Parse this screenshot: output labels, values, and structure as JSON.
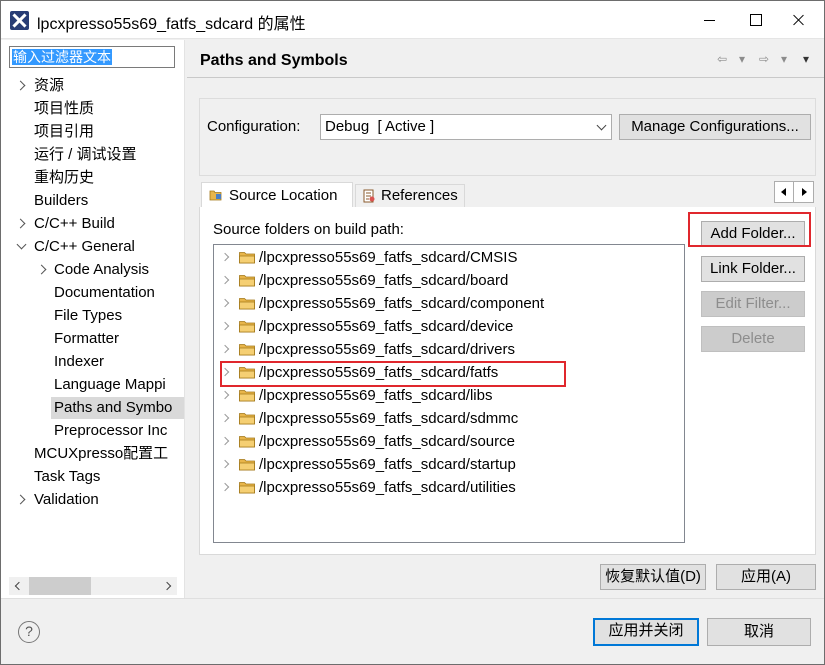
{
  "window": {
    "title": "lpcxpresso55s69_fatfs_sdcard 的属性",
    "icon": "app-x-icon"
  },
  "filter": {
    "value": "输入过滤器文本"
  },
  "nav": {
    "items": [
      {
        "label": "资源",
        "arrow": "right"
      },
      {
        "label": "项目性质",
        "arrow": ""
      },
      {
        "label": "项目引用",
        "arrow": ""
      },
      {
        "label": "运行 / 调试设置",
        "arrow": ""
      },
      {
        "label": "重构历史",
        "arrow": ""
      },
      {
        "label": "Builders",
        "arrow": ""
      },
      {
        "label": "C/C++ Build",
        "arrow": "right"
      },
      {
        "label": "C/C++ General",
        "arrow": "down"
      },
      {
        "label": "Code Analysis",
        "arrow": "right"
      },
      {
        "label": "Documentation",
        "arrow": ""
      },
      {
        "label": "File Types",
        "arrow": ""
      },
      {
        "label": "Formatter",
        "arrow": ""
      },
      {
        "label": "Indexer",
        "arrow": ""
      },
      {
        "label": "Language Mappi",
        "arrow": ""
      },
      {
        "label": "Paths and Symbo",
        "arrow": "",
        "selected": true
      },
      {
        "label": "Preprocessor Inc",
        "arrow": ""
      },
      {
        "label": "MCUXpresso配置工",
        "arrow": ""
      },
      {
        "label": "Task Tags",
        "arrow": ""
      },
      {
        "label": "Validation",
        "arrow": "right"
      }
    ]
  },
  "page": {
    "title": "Paths and Symbols"
  },
  "config": {
    "label": "Configuration:",
    "selected": "Debug  [ Active ]",
    "manage_label": "Manage Configurations..."
  },
  "tabs": {
    "source_location": "Source Location",
    "references": "References"
  },
  "source": {
    "label": "Source folders on build path:",
    "folders": [
      "/lpcxpresso55s69_fatfs_sdcard/CMSIS",
      "/lpcxpresso55s69_fatfs_sdcard/board",
      "/lpcxpresso55s69_fatfs_sdcard/component",
      "/lpcxpresso55s69_fatfs_sdcard/device",
      "/lpcxpresso55s69_fatfs_sdcard/drivers",
      "/lpcxpresso55s69_fatfs_sdcard/fatfs",
      "/lpcxpresso55s69_fatfs_sdcard/libs",
      "/lpcxpresso55s69_fatfs_sdcard/sdmmc",
      "/lpcxpresso55s69_fatfs_sdcard/source",
      "/lpcxpresso55s69_fatfs_sdcard/startup",
      "/lpcxpresso55s69_fatfs_sdcard/utilities"
    ],
    "add_folder": "Add Folder...",
    "link_folder": "Link Folder...",
    "edit_filter": "Edit Filter...",
    "delete": "Delete"
  },
  "footer": {
    "restore_defaults": "恢复默认值(D)",
    "apply": "应用(A)",
    "apply_close": "应用并关闭",
    "cancel": "取消",
    "help": "?"
  },
  "colors": {
    "highlight": "#e0272d",
    "selection": "#3399ff",
    "default_button_border": "#0078d7",
    "folder": "#e8b54a"
  }
}
